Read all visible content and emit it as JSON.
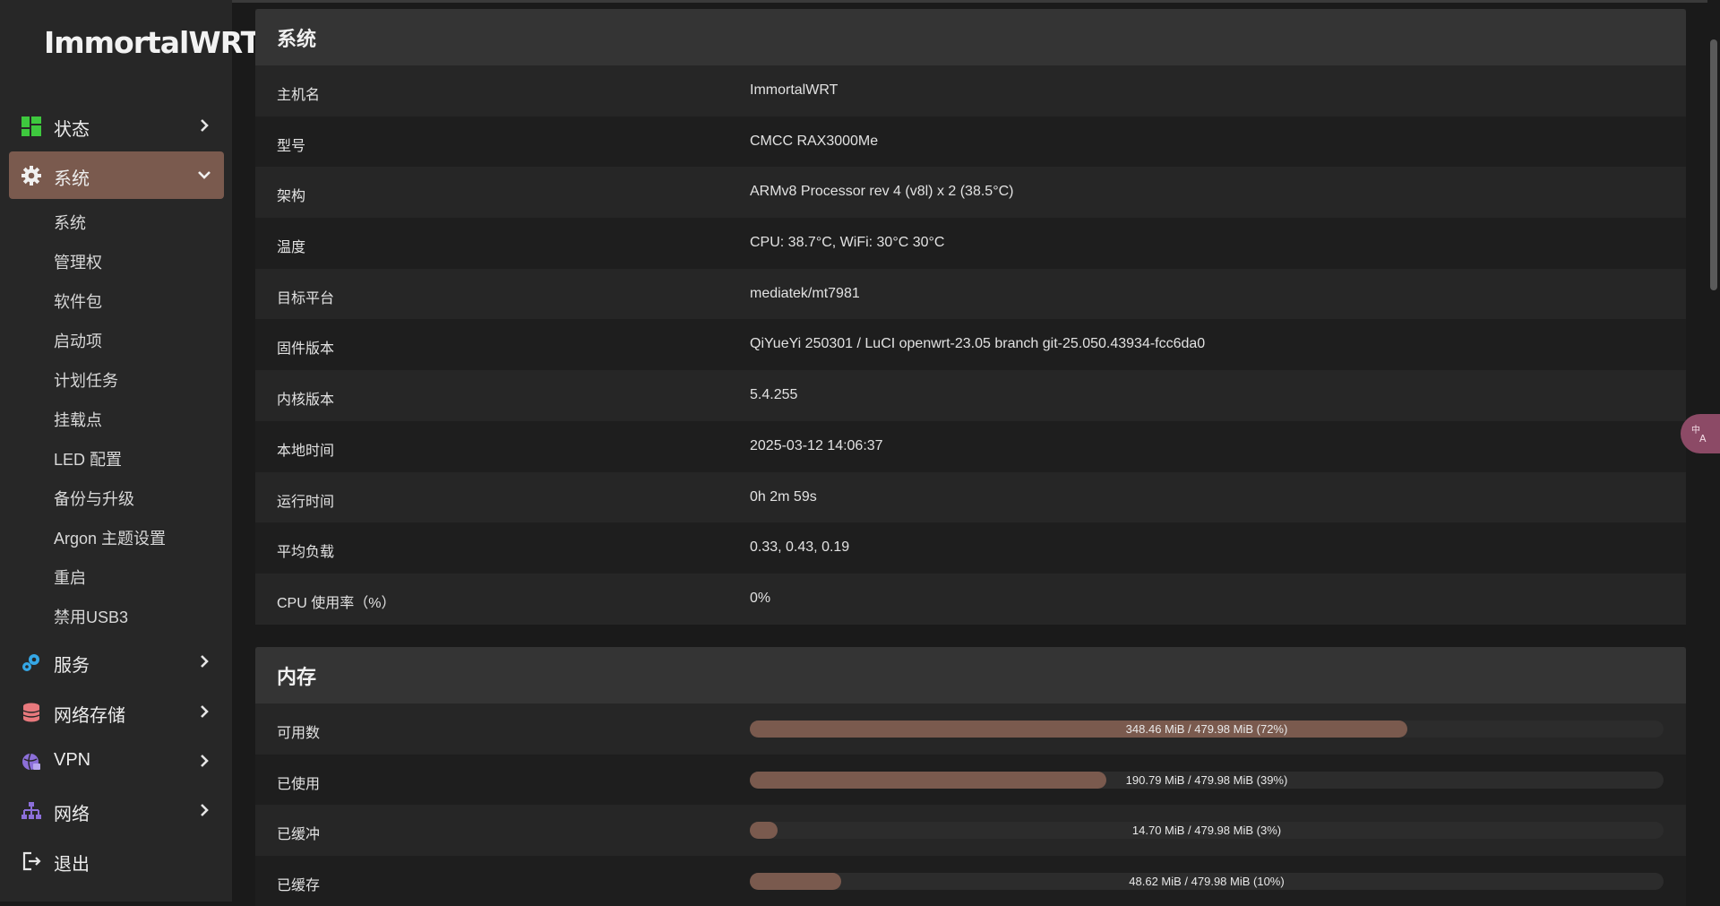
{
  "brand": "ImmortalWRT",
  "nav": {
    "status": {
      "label": "状态",
      "icon": "dashboard-grid-icon",
      "color": "#3ec83e"
    },
    "system": {
      "label": "系统",
      "icon": "gear-icon"
    },
    "services": {
      "label": "服务",
      "icon": "gears-icon",
      "color": "#35a7e6"
    },
    "nas": {
      "label": "网络存储",
      "icon": "database-icon",
      "color": "#e8797d"
    },
    "vpn": {
      "label": "VPN",
      "icon": "globe-lock-icon",
      "color": "#8c6fd9"
    },
    "network": {
      "label": "网络",
      "icon": "network-tree-icon",
      "color": "#8c6fd9"
    },
    "logout": {
      "label": "退出",
      "icon": "logout-icon"
    }
  },
  "system_sub": [
    "系统",
    "管理权",
    "软件包",
    "启动项",
    "计划任务",
    "挂载点",
    "LED 配置",
    "备份与升级",
    "Argon 主题设置",
    "重启",
    "禁用USB3"
  ],
  "system_card": {
    "title": "系统",
    "rows": [
      {
        "key": "主机名",
        "value": "ImmortalWRT"
      },
      {
        "key": "型号",
        "value": "CMCC RAX3000Me"
      },
      {
        "key": "架构",
        "value": "ARMv8 Processor rev 4 (v8l) x 2 (38.5°C)"
      },
      {
        "key": "温度",
        "value": "CPU: 38.7°C, WiFi: 30°C 30°C"
      },
      {
        "key": "目标平台",
        "value": "mediatek/mt7981"
      },
      {
        "key": "固件版本",
        "value": "QiYueYi 250301 / LuCI openwrt-23.05 branch git-25.050.43934-fcc6da0"
      },
      {
        "key": "内核版本",
        "value": "5.4.255"
      },
      {
        "key": "本地时间",
        "value": "2025-03-12 14:06:37"
      },
      {
        "key": "运行时间",
        "value": "0h 2m 59s"
      },
      {
        "key": "平均负载",
        "value": "0.33, 0.43, 0.19"
      },
      {
        "key": "CPU 使用率（%）",
        "value": "0%"
      }
    ]
  },
  "memory_card": {
    "title": "内存",
    "rows": [
      {
        "key": "可用数",
        "text": "348.46 MiB / 479.98 MiB (72%)",
        "percent": 72
      },
      {
        "key": "已使用",
        "text": "190.79 MiB / 479.98 MiB (39%)",
        "percent": 39
      },
      {
        "key": "已缓冲",
        "text": "14.70 MiB / 479.98 MiB (3%)",
        "percent": 3
      },
      {
        "key": "已缓存",
        "text": "48.62 MiB / 479.98 MiB (10%)",
        "percent": 10
      }
    ]
  },
  "translate_button": {
    "icon": "translate-icon"
  },
  "colors": {
    "accent": "#7a5a4e",
    "sidebar_bg": "#272727",
    "card_header": "#343434"
  }
}
